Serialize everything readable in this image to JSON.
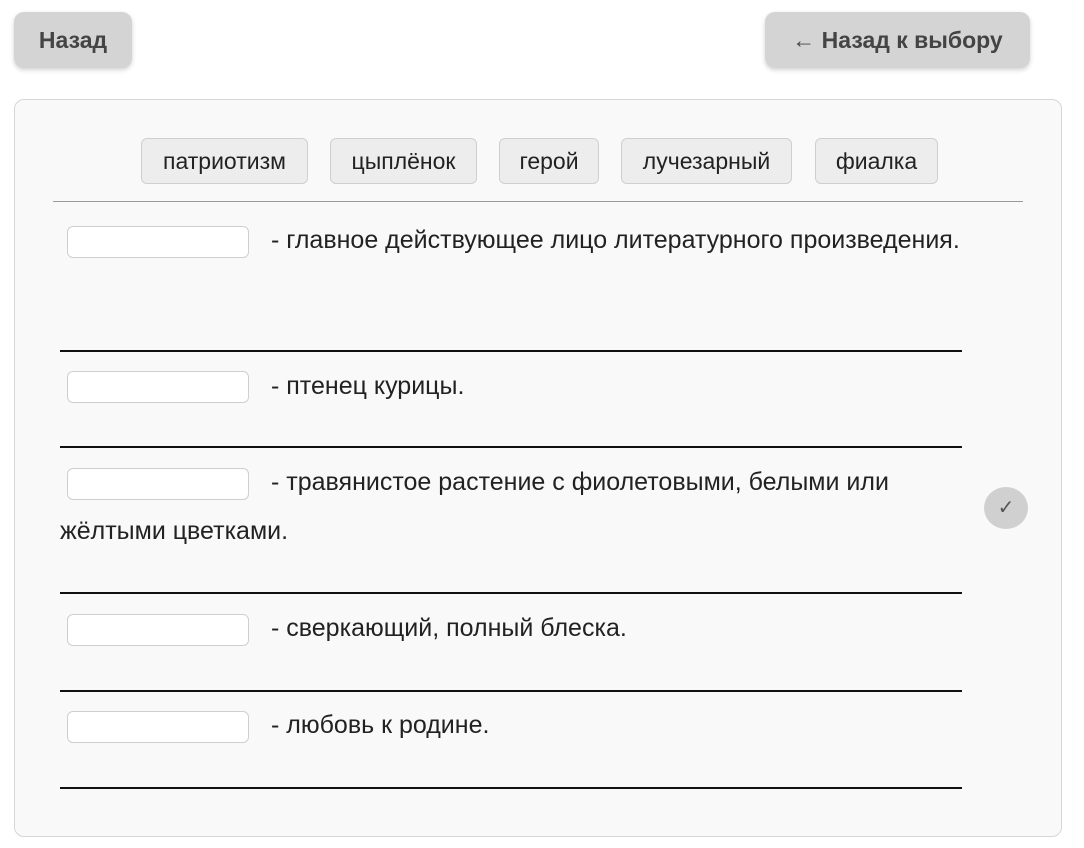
{
  "nav": {
    "back_label": "Назад",
    "back_to_choice_label": "← Назад к выбору"
  },
  "word_bank": [
    "патриотизм",
    "цыплёнок",
    "герой",
    "лучезарный",
    "фиалка"
  ],
  "definitions": [
    {
      "answer": "",
      "text": "- главное действующее лицо литературного произведения."
    },
    {
      "answer": "",
      "text": "- птенец курицы."
    },
    {
      "answer": "",
      "text": "- травянистое растение с фиолетовыми, белыми или жёлтыми цветками."
    },
    {
      "answer": "",
      "text": "- сверкающий, полный блеска."
    },
    {
      "answer": "",
      "text": "- любовь к родине."
    }
  ],
  "check_button": {
    "icon": "checkmark-icon",
    "glyph": "✓"
  }
}
